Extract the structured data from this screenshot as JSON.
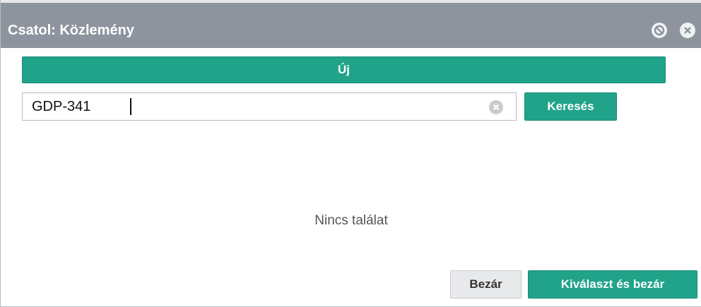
{
  "dialog": {
    "title": "Csatol: Közlemény",
    "minimize_icon": "minimize-circle-icon",
    "close_icon": "close-circle-icon"
  },
  "toolbar": {
    "new_label": "Új"
  },
  "search": {
    "value": "GDP-341",
    "clear_icon": "clear-circle-icon",
    "button_label": "Keresés"
  },
  "results": {
    "empty_text": "Nincs találat"
  },
  "footer": {
    "close_label": "Bezár",
    "select_close_label": "Kiválaszt és bezár"
  },
  "colors": {
    "titlebar": "#8d949e",
    "accent": "#21a38a",
    "secondary_button": "#e8e9eb"
  }
}
